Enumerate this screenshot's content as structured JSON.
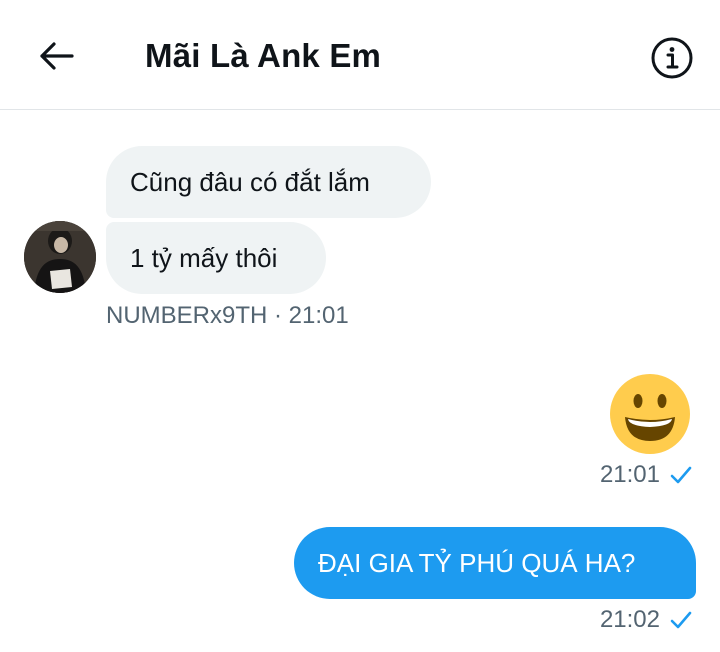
{
  "header": {
    "title": "Mãi Là Ank Em",
    "back_icon": "arrow-left-icon",
    "info_icon": "info-icon"
  },
  "messages": {
    "incoming": [
      {
        "text": "Cũng đâu có đắt lắm"
      },
      {
        "text": "1 tỷ mấy thôi"
      }
    ],
    "incoming_meta": "NUMBERx9TH · 21:01",
    "outgoing": [
      {
        "emoji": "grinning-face-emoji",
        "time": "21:01",
        "status_icon": "check-icon"
      },
      {
        "text": "ĐẠI GIA TỶ PHÚ QUÁ HA?",
        "time": "21:02",
        "status_icon": "check-icon"
      }
    ]
  },
  "colors": {
    "outgoing_bubble": "#1d9bf0",
    "incoming_bubble": "#eff3f4",
    "meta_text": "#536471",
    "check": "#1d9bf0"
  }
}
